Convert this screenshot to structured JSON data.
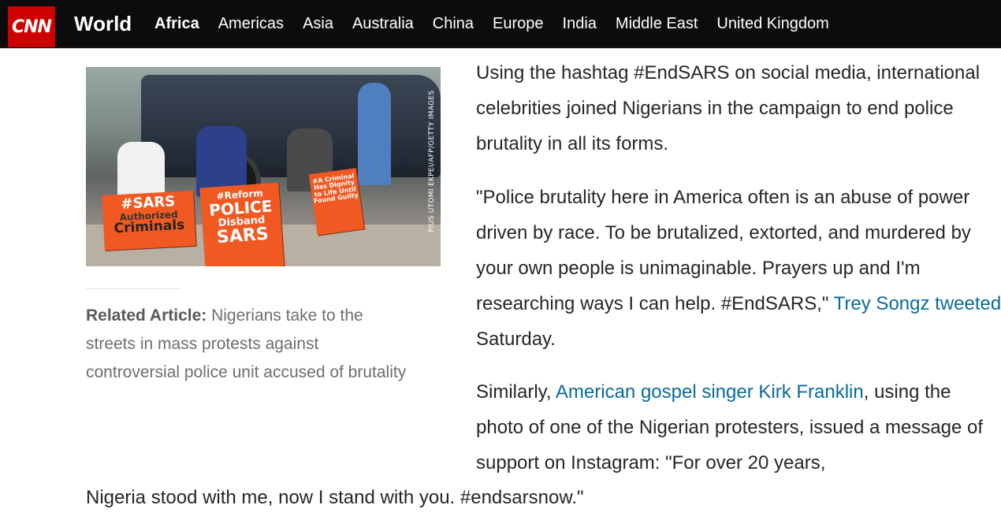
{
  "brand": {
    "logo_text": "CNN",
    "accent": "#cc0000"
  },
  "header": {
    "section": "World",
    "nav": [
      "Africa",
      "Americas",
      "Asia",
      "Australia",
      "China",
      "Europe",
      "India",
      "Middle East",
      "United Kingdom"
    ],
    "active": "Africa"
  },
  "photo": {
    "credit": "PIUS UTOMI EKPEI/AFP/GETTY IMAGES",
    "signs": [
      {
        "lines": [
          "#SARS",
          "Authorized",
          "Criminals"
        ]
      },
      {
        "lines": [
          "#Reform",
          "POLICE",
          "Disband",
          "SARS"
        ]
      },
      {
        "lines": [
          "#A Criminal",
          "Has Dignity",
          "to Life Until",
          "Found Guilty"
        ]
      }
    ]
  },
  "related": {
    "label": "Related Article:",
    "text": " Nigerians take to the streets in mass protests against controversial police unit accused of brutality"
  },
  "article": {
    "p1": "Using the hashtag #EndSARS on social media, international celebrities joined Nigerians in the campaign to end police brutality in all its forms.",
    "p2_text": "\"Police brutality here in America often is an abuse of power driven by race. To be brutalized, extorted, and murdered by your own people is unimaginable. Prayers up and I'm researching ways I can help. #EndSARS,\" ",
    "p2_link": "Trey Songz tweeted",
    "p2_tail": " Saturday.",
    "p3_pre": "Similarly, ",
    "p3_link": "American gospel singer Kirk Franklin",
    "p3_text": ", using the photo of one of the Nigerian protesters, issued a message of support on Instagram: \"For over 20 years,",
    "p3_cont": "Nigeria stood with me, now I stand with you. #endsarsnow.\""
  },
  "colors": {
    "link": "#0c6a9a",
    "nav_bg": "#0c0c0c",
    "body_text": "#262626"
  }
}
